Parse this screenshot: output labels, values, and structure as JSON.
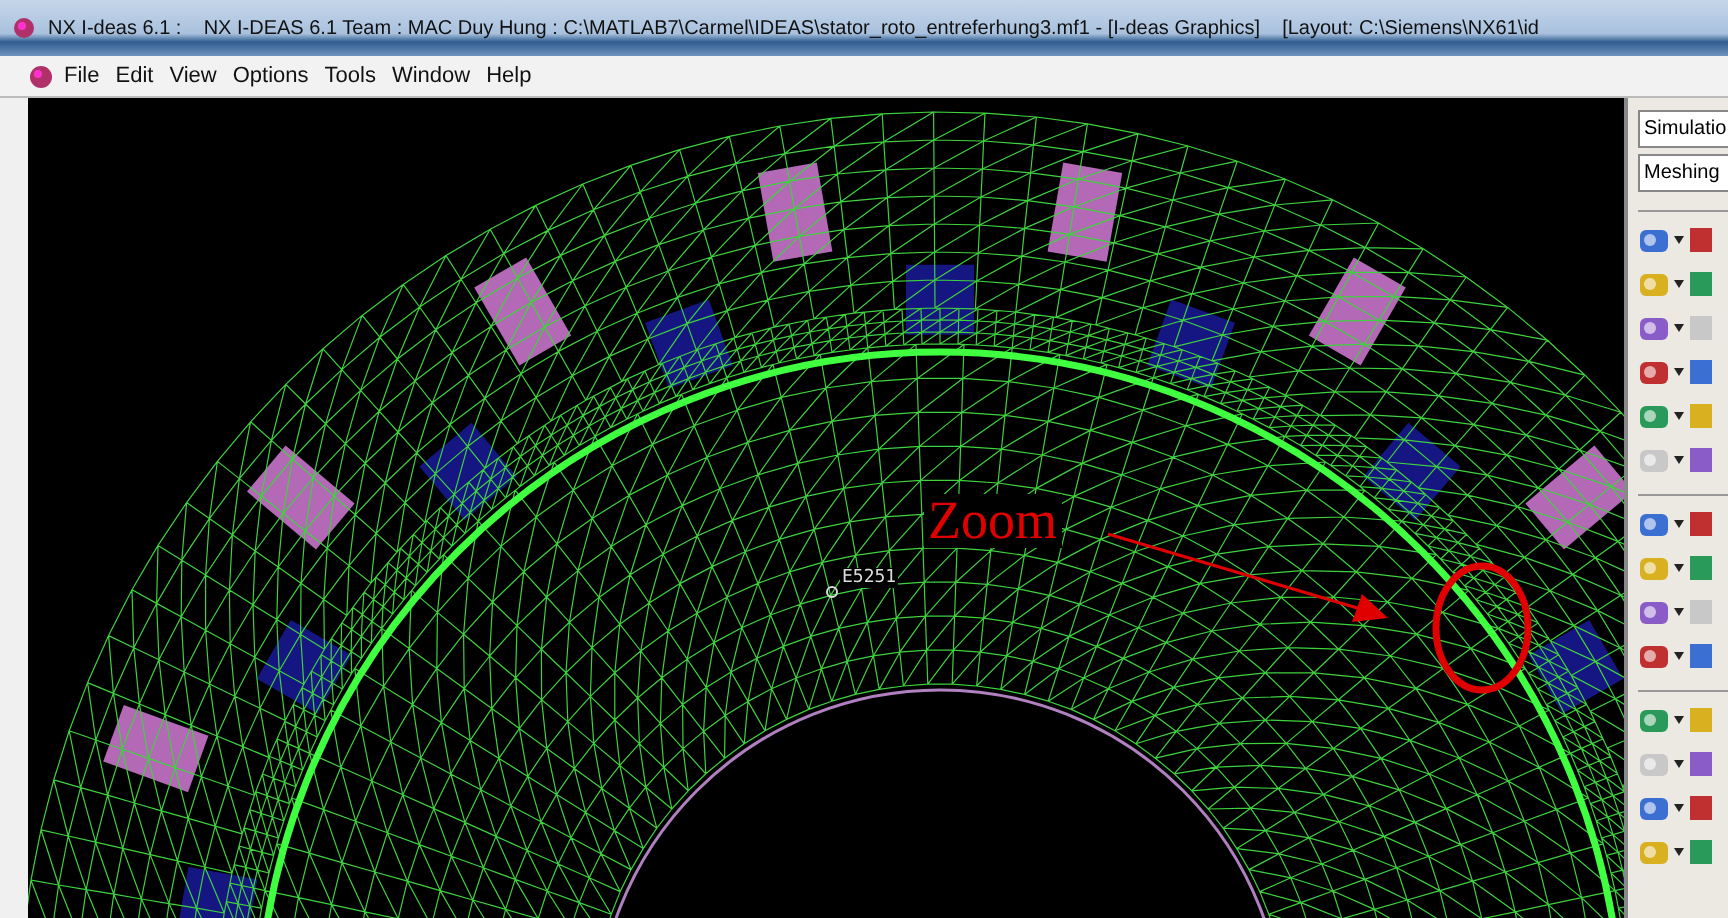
{
  "window": {
    "title": "NX I-deas 6.1 :    NX I-DEAS 6.1 Team : MAC Duy Hung : C:\\MATLAB7\\Carmel\\IDEAS\\stator_roto_entreferhung3.mf1 - [I-deas Graphics]    [Layout: C:\\Siemens\\NX61\\id"
  },
  "menu": [
    "File",
    "Edit",
    "View",
    "Options",
    "Tools",
    "Window",
    "Help"
  ],
  "panel": {
    "task": "Simulatio",
    "application": "Meshing"
  },
  "canvas": {
    "element_label": "E5251",
    "annotation": "Zoom"
  }
}
